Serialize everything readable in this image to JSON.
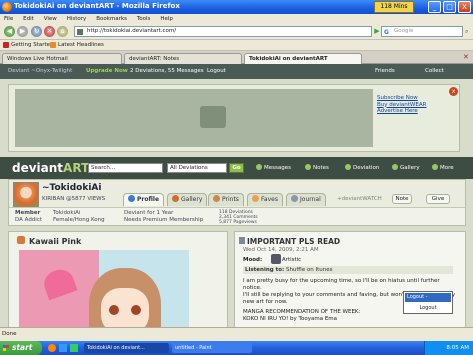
{
  "window": {
    "title": "TokidokiAi on deviantART - Mozilla Firefox",
    "timer": "118 Mins",
    "minimize": "_",
    "maximize": "□",
    "close": "X"
  },
  "menu": [
    "File",
    "Edit",
    "View",
    "History",
    "Bookmarks",
    "Tools",
    "Help"
  ],
  "nav": {
    "url": "http://tokidokiai.deviantart.com/",
    "search_placeholder": "Google"
  },
  "bookmarks": [
    "Getting Started",
    "Latest Headlines"
  ],
  "tabs": [
    "Windows Live Hotmail",
    "deviantART: Notes",
    "TokidokiAi on deviantART"
  ],
  "da_top": {
    "user": "Deviant ~Onyx-Twilight",
    "upgrade": "Upgrade Now",
    "msgs": "2 Deviations, 55 Messages",
    "logout": "Logout",
    "friends": "Friends",
    "collect": "Collect"
  },
  "ad": {
    "link1": "Subscribe Now",
    "link2": "Buy deviantWEAR",
    "link3": "Advertise Here",
    "close": "x"
  },
  "da_bar": {
    "logo_a": "deviant",
    "logo_b": "ART",
    "search": "Search...",
    "select": "All Deviations",
    "go": "Go",
    "messages": "Messages",
    "notes": "Notes",
    "deviation": "Deviation",
    "gallery": "Gallery",
    "more": "More"
  },
  "profile": {
    "name": "~TokidokiAi",
    "kiriban": "KIRIBAN @5877 VIEWS",
    "tabs": [
      "Profile",
      "Gallery",
      "Prints",
      "Faves",
      "Journal"
    ],
    "watch": "+deviantWATCH",
    "note": "Note",
    "give": "Give",
    "member_label": "Member",
    "member_value": "DA Addict",
    "name_label": "TokidokiAi",
    "location": "Female/Hong Kong",
    "deviant_for": "Deviant for 1 Year",
    "premium": "Needs Premium Membership",
    "stat1": "118 Deviations",
    "stat2": "2,341 Comments",
    "stat3": "5,877 Pageviews"
  },
  "left_panel": {
    "title": "Kawaii Pink"
  },
  "right_panel": {
    "title": "IMPORTANT PLS READ",
    "date": "Wed Oct 14, 2009, 2:21 AM",
    "mood_label": "Mood:",
    "mood_value": "Artistic",
    "listening_label": "Listening to:",
    "listening_value": "Shuffle on Itunes",
    "line1": "I am pretty busy for the upcoming time, so I'll be on hiatus until further notice.",
    "line2": "I'll still be replying to your comments and faving, but won't be uploading any new art for now.",
    "line3": "MANGA RECOMMENDATION OF THE WEEK:",
    "line4": "KOKO NI IRU YO! by Tooyama Ema"
  },
  "context_menu": {
    "item1": "Logout - CybrayAlllmi",
    "item2": "Logout"
  },
  "status": "Done",
  "taskbar": {
    "start": "start",
    "t1": "TokidokiAi on deviant...",
    "t2": "untitled - Paint",
    "clock": "8:05 AM"
  }
}
